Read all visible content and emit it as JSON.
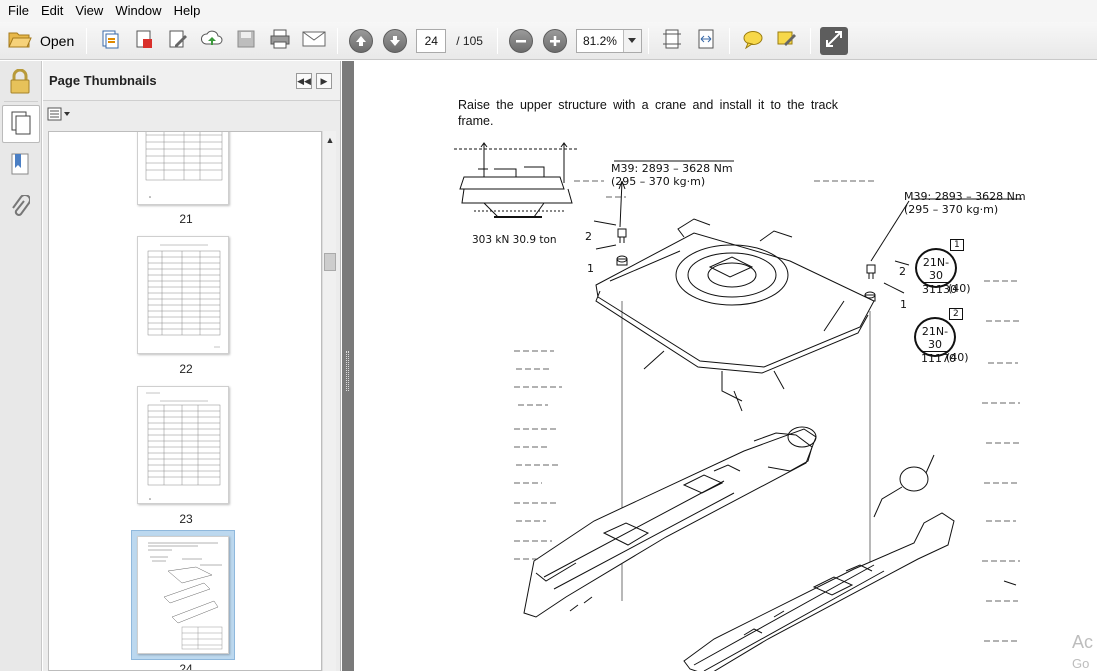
{
  "menu": {
    "items": [
      "File",
      "Edit",
      "View",
      "Window",
      "Help"
    ]
  },
  "toolbar": {
    "open_label": "Open",
    "current_page": "24",
    "total_pages": "/ 105",
    "zoom": "81.2%"
  },
  "thumbnails": {
    "title": "Page Thumbnails",
    "pages": [
      {
        "number": "21"
      },
      {
        "number": "22"
      },
      {
        "number": "23"
      },
      {
        "number": "24",
        "selected": true
      }
    ]
  },
  "document": {
    "instruction": "Raise the upper structure with a crane and install it to the track frame.",
    "crane_caption": "303 kN 30.9 ton",
    "torque_left_line1": "M39: 2893 – 3628 Nm",
    "torque_left_line2": "(295 – 370 kg·m)",
    "torque_right_line1": "M39: 2893 – 3628 Nm",
    "torque_right_line2": "(295 – 370 kg·m)",
    "callout_1a": "2",
    "callout_1b": "1",
    "callout_2a": "2",
    "callout_2b": "1",
    "tag_1": "1",
    "tag_2": "2",
    "part_1_line1": "21N-30",
    "part_1_line2": "31130",
    "part_1_qty": "(40)",
    "part_2_line1": "21N-30",
    "part_2_line2": "11170",
    "part_2_qty": "(40)"
  },
  "watermark": {
    "line1": "Ac",
    "line2": "Go"
  },
  "icons": [
    "folder-open-icon",
    "create-pdf-icon",
    "convert-icon",
    "edit-icon",
    "upload-icon",
    "save-icon",
    "print-icon",
    "email-icon",
    "prev-page-icon",
    "next-page-icon",
    "zoom-out-icon",
    "zoom-in-icon",
    "fit-page-icon",
    "fit-width-icon",
    "comment-icon",
    "highlight-icon",
    "expand-icon",
    "lock-icon",
    "pages-icon",
    "bookmark-icon",
    "attachment-icon"
  ]
}
